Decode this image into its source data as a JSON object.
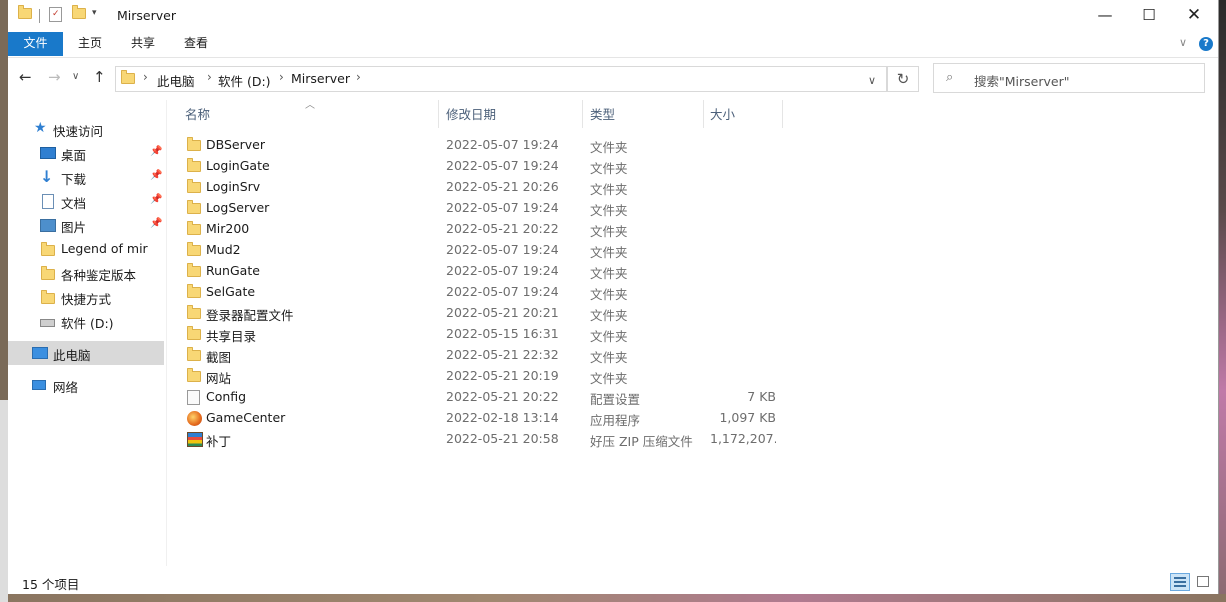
{
  "window": {
    "title": "Mirserver"
  },
  "ribbon": {
    "tabs": [
      "文件",
      "主页",
      "共享",
      "查看"
    ]
  },
  "address": {
    "crumbs": [
      "此电脑",
      "软件 (D:)",
      "Mirserver"
    ]
  },
  "search": {
    "placeholder": "搜索\"Mirserver\""
  },
  "sidebar": {
    "quick_access": "快速访问",
    "items": [
      {
        "label": "桌面",
        "icon": "desktop-icon",
        "pinned": true
      },
      {
        "label": "下载",
        "icon": "download-icon",
        "pinned": true
      },
      {
        "label": "文档",
        "icon": "documents-icon",
        "pinned": true
      },
      {
        "label": "图片",
        "icon": "pictures-icon",
        "pinned": true
      },
      {
        "label": "Legend of mir",
        "icon": "folder-icon",
        "pinned": false
      },
      {
        "label": "各种鉴定版本",
        "icon": "folder-icon",
        "pinned": false
      },
      {
        "label": "快捷方式",
        "icon": "folder-icon",
        "pinned": false
      },
      {
        "label": "软件 (D:)",
        "icon": "drive-icon",
        "pinned": false
      }
    ],
    "this_pc": "此电脑",
    "network": "网络"
  },
  "columns": {
    "name": "名称",
    "date": "修改日期",
    "type": "类型",
    "size": "大小"
  },
  "files": [
    {
      "name": "DBServer",
      "date": "2022-05-07 19:24",
      "type": "文件夹",
      "size": "",
      "icon": "folder"
    },
    {
      "name": "LoginGate",
      "date": "2022-05-07 19:24",
      "type": "文件夹",
      "size": "",
      "icon": "folder"
    },
    {
      "name": "LoginSrv",
      "date": "2022-05-21 20:26",
      "type": "文件夹",
      "size": "",
      "icon": "folder"
    },
    {
      "name": "LogServer",
      "date": "2022-05-07 19:24",
      "type": "文件夹",
      "size": "",
      "icon": "folder"
    },
    {
      "name": "Mir200",
      "date": "2022-05-21 20:22",
      "type": "文件夹",
      "size": "",
      "icon": "folder"
    },
    {
      "name": "Mud2",
      "date": "2022-05-07 19:24",
      "type": "文件夹",
      "size": "",
      "icon": "folder"
    },
    {
      "name": "RunGate",
      "date": "2022-05-07 19:24",
      "type": "文件夹",
      "size": "",
      "icon": "folder"
    },
    {
      "name": "SelGate",
      "date": "2022-05-07 19:24",
      "type": "文件夹",
      "size": "",
      "icon": "folder"
    },
    {
      "name": "登录器配置文件",
      "date": "2022-05-21 20:21",
      "type": "文件夹",
      "size": "",
      "icon": "folder"
    },
    {
      "name": "共享目录",
      "date": "2022-05-15 16:31",
      "type": "文件夹",
      "size": "",
      "icon": "folder"
    },
    {
      "name": "截图",
      "date": "2022-05-21 22:32",
      "type": "文件夹",
      "size": "",
      "icon": "folder"
    },
    {
      "name": "网站",
      "date": "2022-05-21 20:19",
      "type": "文件夹",
      "size": "",
      "icon": "folder"
    },
    {
      "name": "Config",
      "date": "2022-05-21 20:22",
      "type": "配置设置",
      "size": "7 KB",
      "icon": "config"
    },
    {
      "name": "GameCenter",
      "date": "2022-02-18 13:14",
      "type": "应用程序",
      "size": "1,097 KB",
      "icon": "app"
    },
    {
      "name": "补丁",
      "date": "2022-05-21 20:58",
      "type": "好压 ZIP 压缩文件",
      "size": "1,172,207...",
      "icon": "zip"
    }
  ],
  "status": {
    "count_text": "15 个项目"
  }
}
